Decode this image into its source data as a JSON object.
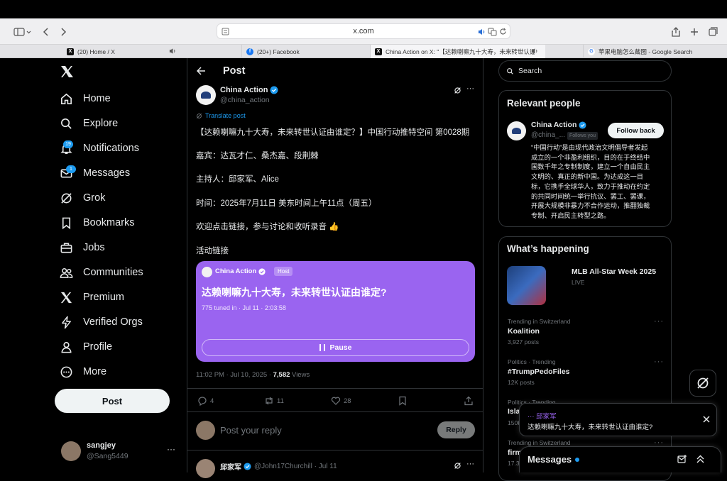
{
  "browser": {
    "url": "x.com",
    "tabs": [
      {
        "title": "(20) Home / X",
        "icon": "x-logo-icon"
      },
      {
        "title": "(20+) Facebook",
        "icon": "facebook-icon"
      },
      {
        "title": "China Action on X: \"【达赖喇嘛九十大寿，未来转世认证由...",
        "icon": "x-logo-icon"
      },
      {
        "title": "苹果电脑怎么截图 - Google Search",
        "icon": "google-icon"
      }
    ]
  },
  "sidebar": {
    "nav": [
      {
        "label": "Home",
        "icon": "home-icon"
      },
      {
        "label": "Explore",
        "icon": "search-icon"
      },
      {
        "label": "Notifications",
        "icon": "bell-icon",
        "badge": "19"
      },
      {
        "label": "Messages",
        "icon": "mail-icon",
        "badge": "1"
      },
      {
        "label": "Grok",
        "icon": "grok-icon"
      },
      {
        "label": "Bookmarks",
        "icon": "bookmark-icon"
      },
      {
        "label": "Jobs",
        "icon": "briefcase-icon"
      },
      {
        "label": "Communities",
        "icon": "people-icon"
      },
      {
        "label": "Premium",
        "icon": "x-logo-icon"
      },
      {
        "label": "Verified Orgs",
        "icon": "lightning-icon"
      },
      {
        "label": "Profile",
        "icon": "person-icon"
      },
      {
        "label": "More",
        "icon": "more-circle-icon"
      }
    ],
    "post_button": "Post",
    "account": {
      "name": "sangjey",
      "handle": "@Sang5449"
    }
  },
  "post": {
    "header": "Post",
    "author_name": "China Action",
    "author_handle": "@china_action",
    "translate": "Translate post",
    "lines": [
      "【达赖喇嘛九十大寿，未来转世认证由谁定？】中国行动推特空间 第0028期",
      "嘉宾：达瓦才仁、桑杰嘉、段荆棘",
      "主持人：邱家军、Alice",
      "时间：2025年7月11日 美东时间上午11点（周五）",
      "欢迎点击链接，参与讨论和收听录音 👍",
      "活动链接"
    ],
    "space": {
      "host_name": "China Action",
      "host_tag": "Host",
      "title": "达赖喇嘛九十大寿，未来转世认证由谁定?",
      "meta": "775 tuned in · Jul 11 · 2:03:58",
      "button": "Pause"
    },
    "timestamp": "11:02 PM · Jul 10, 2025 · ",
    "views_count": "7,582",
    "views_label": " Views",
    "actions": {
      "replies": "4",
      "reposts": "11",
      "likes": "28"
    },
    "reply_placeholder": "Post your reply",
    "reply_button": "Reply",
    "next_reply": {
      "name": "邱家军",
      "handle": "@John17Churchill · Jul 11"
    }
  },
  "right": {
    "search_placeholder": "Search",
    "relevant": {
      "title": "Relevant people",
      "name": "China Action",
      "handle": "@china_...",
      "follows_you": "Follows you",
      "follow_button": "Follow back",
      "bio": [
        "“中国行动”是由现代政治文明倡导者发起",
        "成立的一个非盈利组织，目的在于终结中",
        "国数千年之专制制度，建立一个自由民主",
        "文明的、真正的新中国。为达成这一目",
        "标，它携手全球华人，致力于推动在约定",
        "的共同时间统一举行抗议、罢工、罢课，",
        "开展大规模非暴力不合作运动，推翻独裁",
        "专制、开启民主转型之路。"
      ]
    },
    "happening": {
      "title": "What’s happening",
      "featured_title": "MLB All-Star Week 2025",
      "featured_sub": "LIVE",
      "trends": [
        {
          "context": "Trending in Switzerland",
          "name": "Koalition",
          "posts": "3,927 posts"
        },
        {
          "context": "Politics · Trending",
          "name": "#TrumpPedoFiles",
          "posts": "12K posts"
        },
        {
          "context": "Politics · Trending",
          "name": "Isla",
          "posts": "150K"
        },
        {
          "context": "Trending in Switzerland",
          "name": "firm",
          "posts": "17.3K"
        }
      ]
    },
    "popup": {
      "title": "··· 邱家军",
      "text": "达赖喇嘛九十大寿，未来转世认证由谁定?"
    },
    "messages_bar": "Messages"
  },
  "colors": {
    "accent": "#1d9bf0",
    "space": "#9a64f0",
    "border": "#2f3336",
    "muted": "#71767b"
  }
}
